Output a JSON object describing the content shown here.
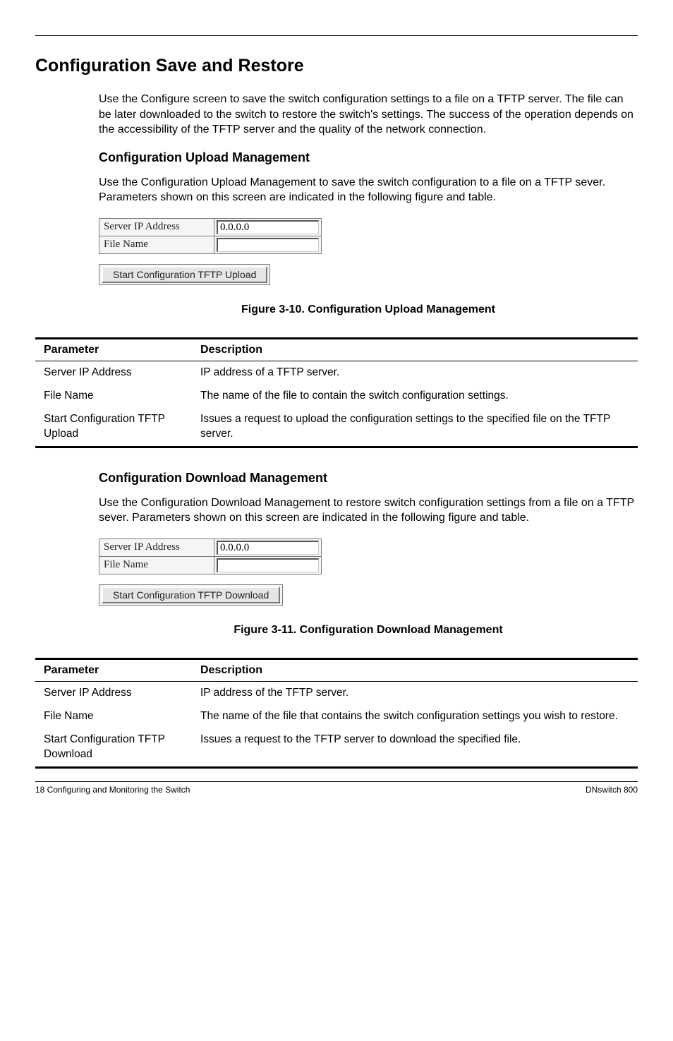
{
  "section_title": "Configuration Save and Restore",
  "intro": "Use the Configure screen to save the switch configuration settings to a file on a TFTP server. The file can be later downloaded to the switch to restore the switch's settings. The success of the operation depends on the accessibility of the TFTP server and the quality of the network connection.",
  "upload": {
    "heading": "Configuration Upload Management",
    "para": "Use the Configuration Upload Management to save the switch configuration to a file on a TFTP sever. Parameters shown on this screen are indicated in the following figure and table.",
    "server_ip_label": "Server IP Address",
    "server_ip_value": "0.0.0.0",
    "file_name_label": "File Name",
    "file_name_value": "",
    "button_label": "Start Configuration TFTP Upload",
    "fig_caption": "Figure 3-10.  Configuration Upload Management",
    "table": {
      "head_param": "Parameter",
      "head_desc": "Description",
      "rows": [
        {
          "param": "Server IP Address",
          "desc": "IP address of a TFTP server."
        },
        {
          "param": "File Name",
          "desc": "The name of the file to contain the switch configuration settings."
        },
        {
          "param": "Start Configuration TFTP Upload",
          "desc": "Issues a request to upload the configuration settings to the specified file on the TFTP server."
        }
      ]
    }
  },
  "download": {
    "heading": "Configuration Download Management",
    "para": "Use the Configuration Download Management to restore switch configuration settings from a file on a TFTP sever. Parameters shown on this screen are indicated in the following figure and table.",
    "server_ip_label": "Server IP Address",
    "server_ip_value": "0.0.0.0",
    "file_name_label": "File Name",
    "file_name_value": "",
    "button_label": "Start Configuration TFTP Download",
    "fig_caption": "Figure 3-11.  Configuration Download Management",
    "table": {
      "head_param": "Parameter",
      "head_desc": "Description",
      "rows": [
        {
          "param": "Server IP Address",
          "desc": "IP address of the TFTP server."
        },
        {
          "param": "File Name",
          "desc": "The name of the file that contains the switch configuration settings you wish to restore."
        },
        {
          "param": "Start Configuration TFTP Download",
          "desc": "Issues a request to the TFTP server to download the specified file."
        }
      ]
    }
  },
  "footer_left": "18  Configuring and Monitoring the Switch",
  "footer_right": "DNswitch 800"
}
